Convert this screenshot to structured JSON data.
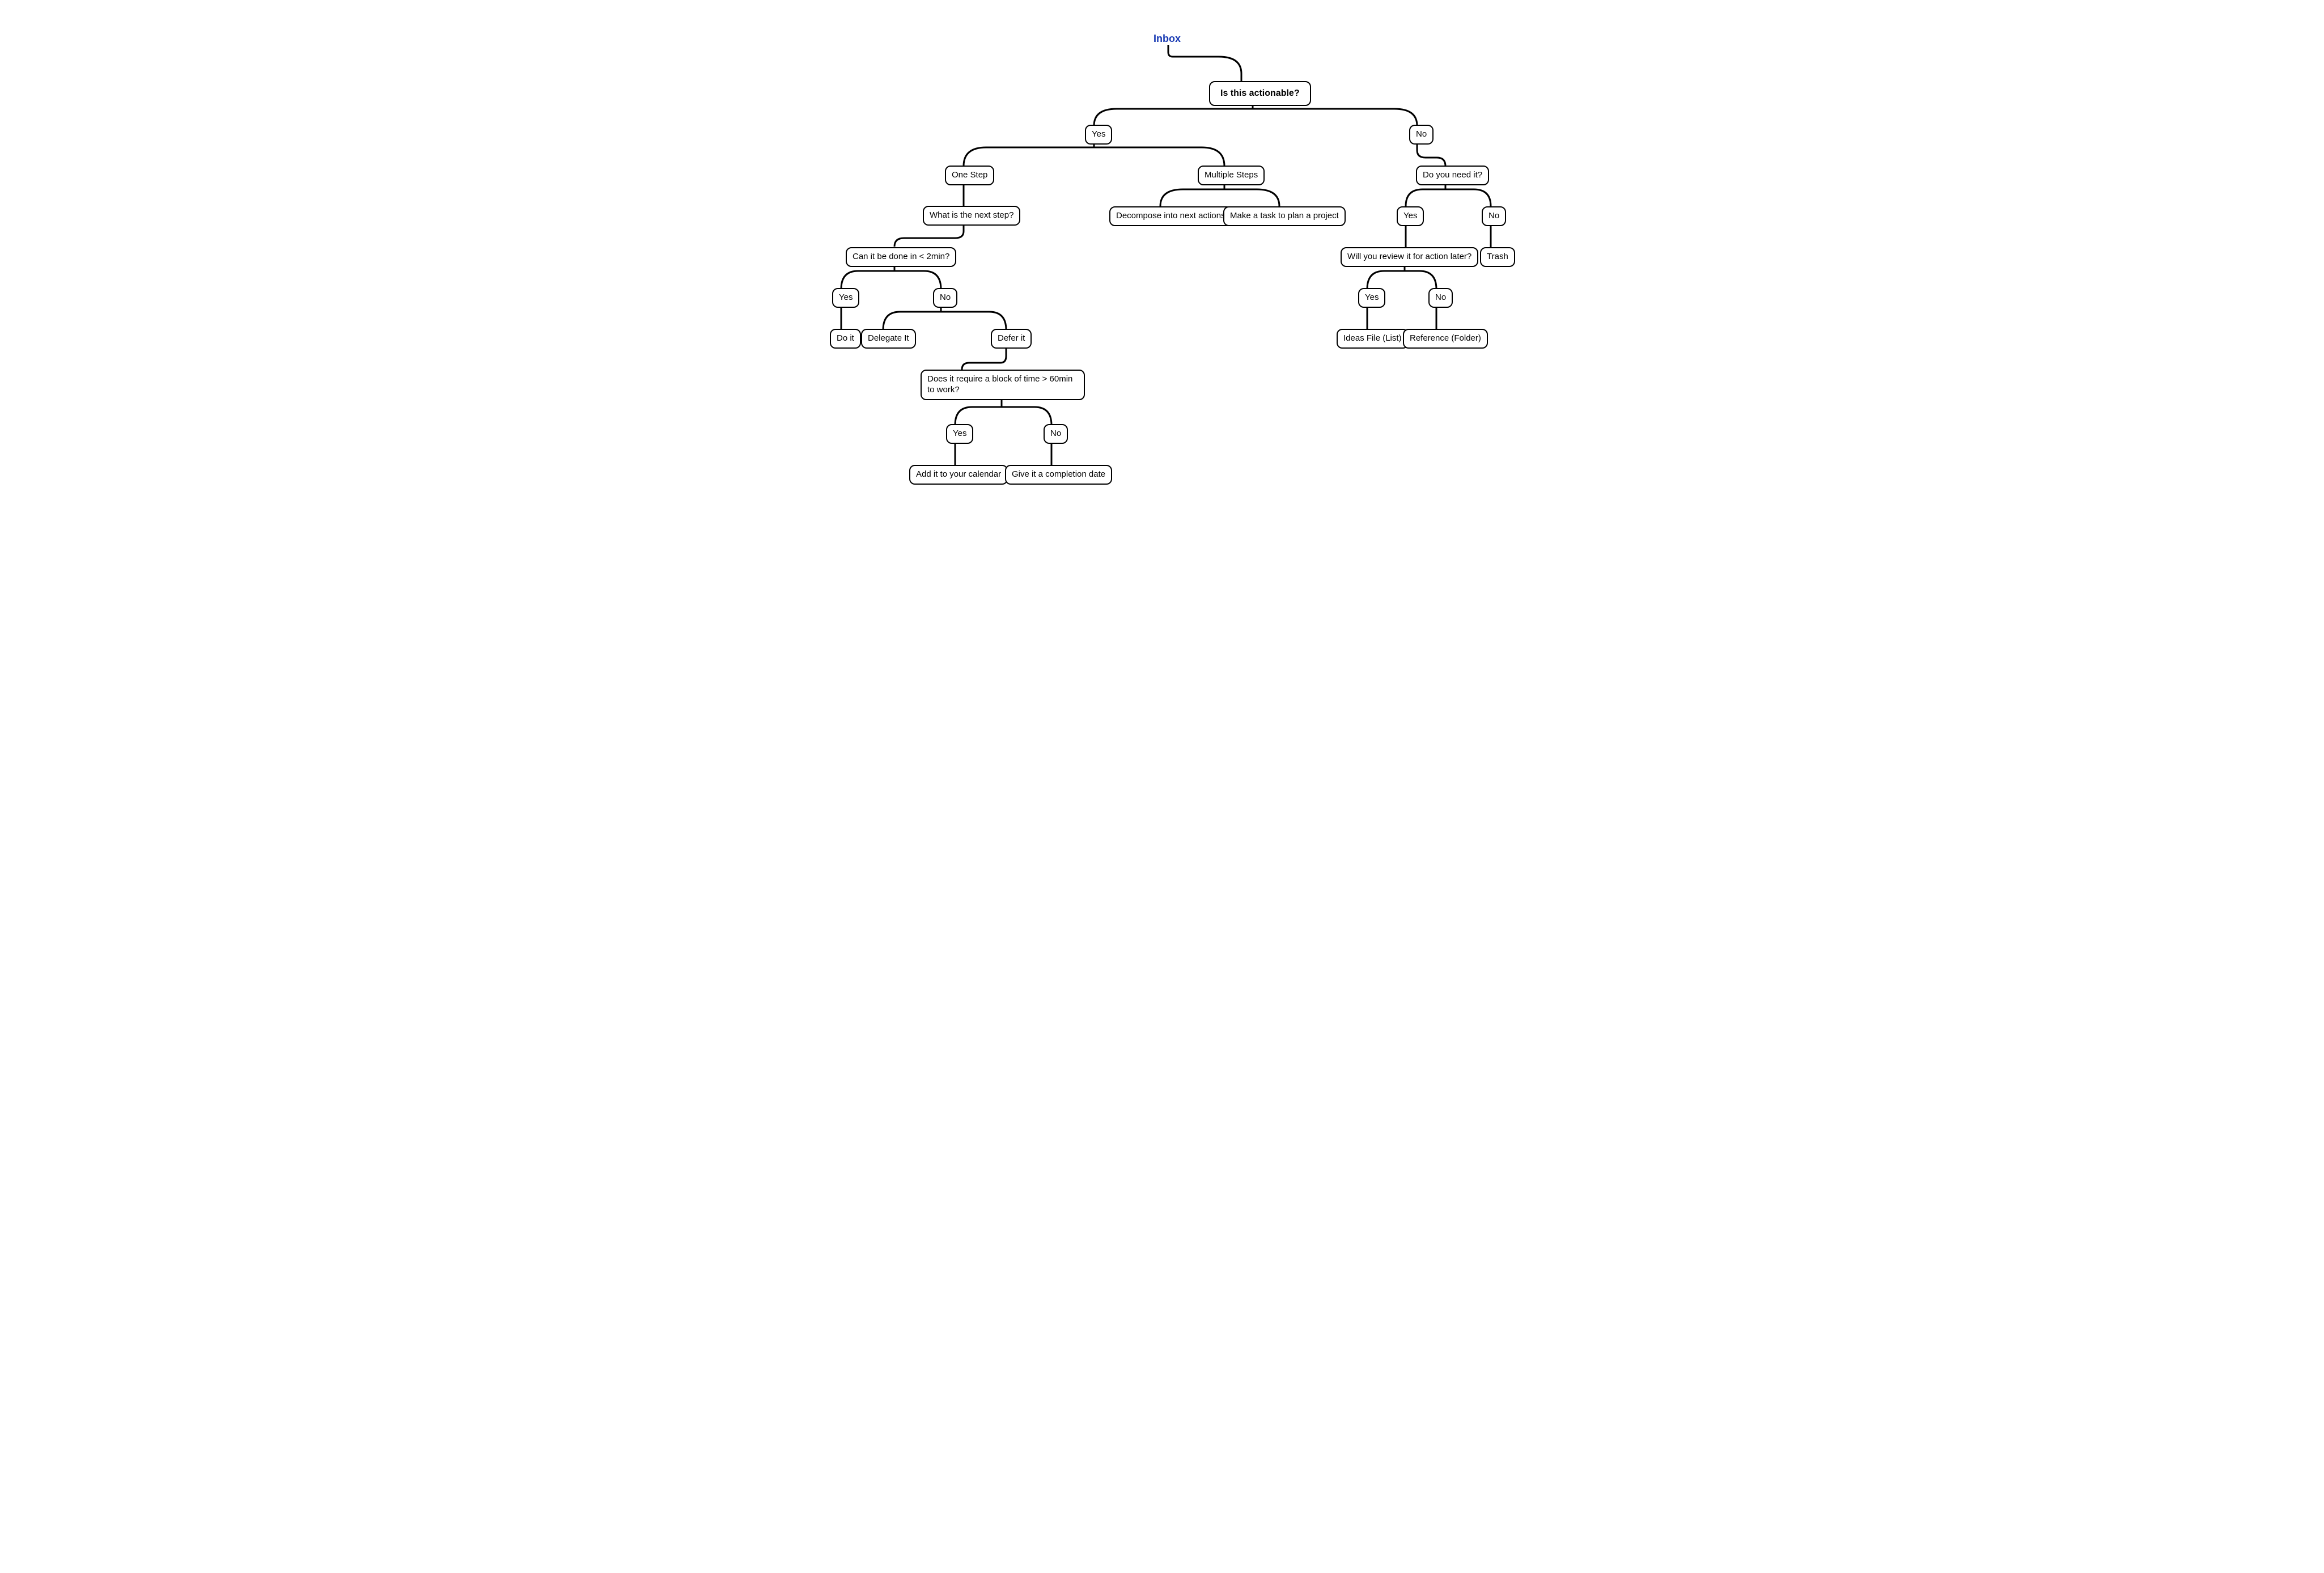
{
  "root": {
    "label": "Inbox"
  },
  "nodes": {
    "actionable": "Is this actionable?",
    "yes1": "Yes",
    "no1": "No",
    "one_step": "One Step",
    "multi": "Multiple Steps",
    "need": "Do you need it?",
    "next_step": "What is the next step?",
    "decompose": "Decompose into next actions",
    "plan_project": "Make a task to plan a project",
    "need_yes": "Yes",
    "need_no": "No",
    "two_min": "Can it be done in < 2min?",
    "review": "Will you review it for action later?",
    "trash": "Trash",
    "tm_yes": "Yes",
    "tm_no": "No",
    "do_it": "Do it",
    "delegate": "Delegate It",
    "defer": "Defer it",
    "rv_yes": "Yes",
    "rv_no": "No",
    "ideas": "Ideas File (List)",
    "reference": "Reference (Folder)",
    "block": "Does it require a block of time > 60min to work?",
    "bl_yes": "Yes",
    "bl_no": "No",
    "calendar": "Add it to your calendar",
    "compdate": "Give it a completion date"
  }
}
